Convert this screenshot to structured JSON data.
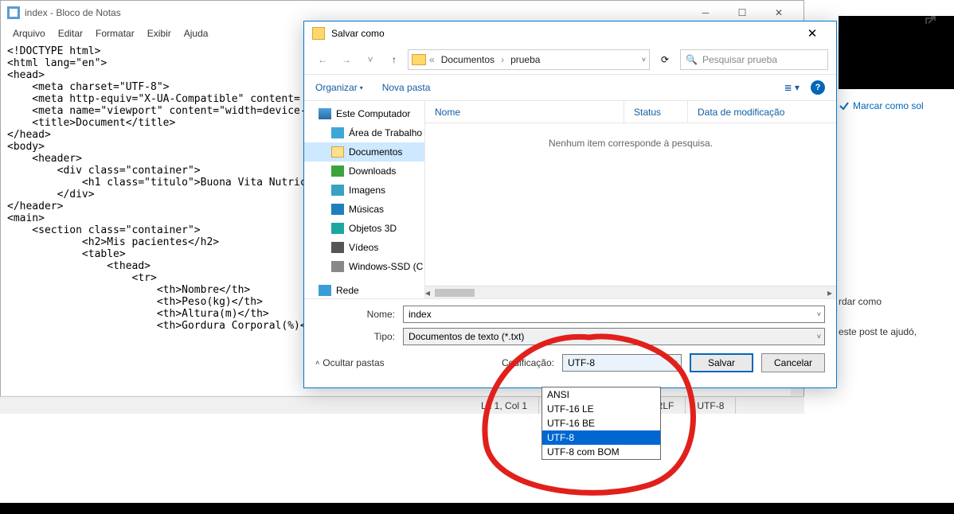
{
  "notepad": {
    "title": "index - Bloco de Notas",
    "menu": [
      "Arquivo",
      "Editar",
      "Formatar",
      "Exibir",
      "Ajuda"
    ],
    "content": "<!DOCTYPE html>\n<html lang=\"en\">\n<head>\n    <meta charset=\"UTF-8\">\n    <meta http-equiv=\"X-UA-Compatible\" content=\n    <meta name=\"viewport\" content=\"width=device-\n    <title>Document</title>\n</head>\n<body>\n    <header>\n        <div class=\"container\">\n            <h1 class=\"titulo\">Buona Vita Nutrició\n        </div>\n</header>\n<main>\n    <section class=\"container\">\n            <h2>Mis pacientes</h2>\n            <table>\n                <thead>\n                    <tr>\n                        <th>Nombre</th>\n                        <th>Peso(kg)</th>\n                        <th>Altura(m)</th>\n                        <th>Gordura Corporal(%)</t",
    "status": {
      "pos": "Ln 1, Col 1",
      "crlf": "(CRLF",
      "enc": "UTF-8"
    }
  },
  "saveas": {
    "title": "Salvar como",
    "breadcrumb": {
      "sep1": "«",
      "p1": "Documentos",
      "p2": "prueba"
    },
    "search_placeholder": "Pesquisar prueba",
    "toolbar": {
      "organize": "Organizar",
      "new_folder": "Nova pasta"
    },
    "tree": {
      "pc": "Este Computador",
      "desktop": "Área de Trabalho",
      "documents": "Documentos",
      "downloads": "Downloads",
      "images": "Imagens",
      "music": "Músicas",
      "objects3d": "Objetos 3D",
      "videos": "Vídeos",
      "ssd": "Windows-SSD (C",
      "network": "Rede"
    },
    "list": {
      "col_name": "Nome",
      "col_status": "Status",
      "col_modified": "Data de modificação",
      "empty": "Nenhum item corresponde à pesquisa."
    },
    "fields": {
      "name_label": "Nome:",
      "name_value": "index",
      "type_label": "Tipo:",
      "type_value": "Documentos de texto (*.txt)"
    },
    "bottom": {
      "hide": "Ocultar pastas",
      "enc_label": "Codificação:",
      "enc_value": "UTF-8",
      "save": "Salvar",
      "cancel": "Cancelar"
    },
    "enc_options": [
      "ANSI",
      "UTF-16 LE",
      "UTF-16 BE",
      "UTF-8",
      "UTF-8 com BOM"
    ],
    "enc_selected_index": 3
  },
  "context": {
    "mark": "Marcar como sol",
    "line1": "rdar como",
    "line2": "este post te ajudó,"
  }
}
